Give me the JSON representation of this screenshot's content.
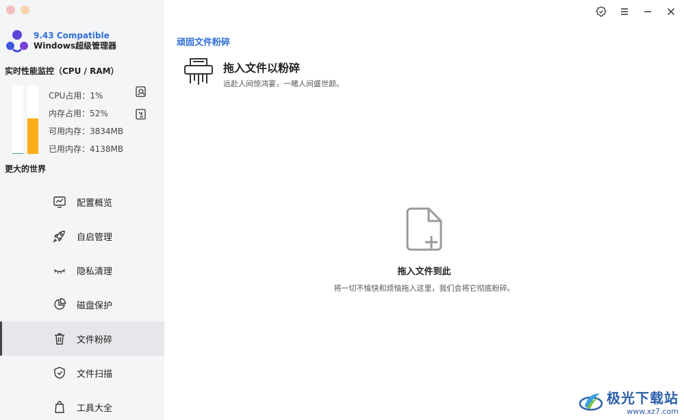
{
  "sidebar": {
    "brand": {
      "version": "9.43 Compatible",
      "name": "Windows超级管理器"
    },
    "monitor": {
      "title": "实时性能监控（CPU / RAM）",
      "cpu_percent": 1,
      "ram_percent": 52,
      "cpu_label": "CPU占用：1%",
      "ram_label": "内存占用：52%",
      "available_label": "可用内存：3834MB",
      "used_label": "已用内存：4138MB"
    },
    "world_label": "更大的世界",
    "nav": [
      {
        "label": "配置概览",
        "icon": "monitor-chart-icon",
        "active": false
      },
      {
        "label": "自启管理",
        "icon": "rocket-icon",
        "active": false
      },
      {
        "label": "隐私清理",
        "icon": "closed-eye-icon",
        "active": false
      },
      {
        "label": "磁盘保护",
        "icon": "pie-chart-icon",
        "active": false
      },
      {
        "label": "文件粉碎",
        "icon": "trash-icon",
        "active": true
      },
      {
        "label": "文件扫描",
        "icon": "shield-check-icon",
        "active": false
      },
      {
        "label": "工具大全",
        "icon": "bag-icon",
        "active": false
      }
    ]
  },
  "main": {
    "page_title": "顽固文件粉碎",
    "feature": {
      "title": "拖入文件以粉碎",
      "subtitle": "远赴人间惊鸿宴，一睹人间盛世颜。"
    },
    "drop": {
      "title": "拖入文件到此",
      "description": "将一切不愉快和烦恼拖入这里，我们会将它彻底粉碎。"
    }
  },
  "watermark": {
    "name": "极光下载站",
    "url": "www.xz7.com"
  },
  "colors": {
    "accent": "#2f6fd6",
    "cpu_bar": "#2bb673",
    "ram_bar": "#f9ae1a",
    "sidebar_bg": "#f4f5f7"
  }
}
